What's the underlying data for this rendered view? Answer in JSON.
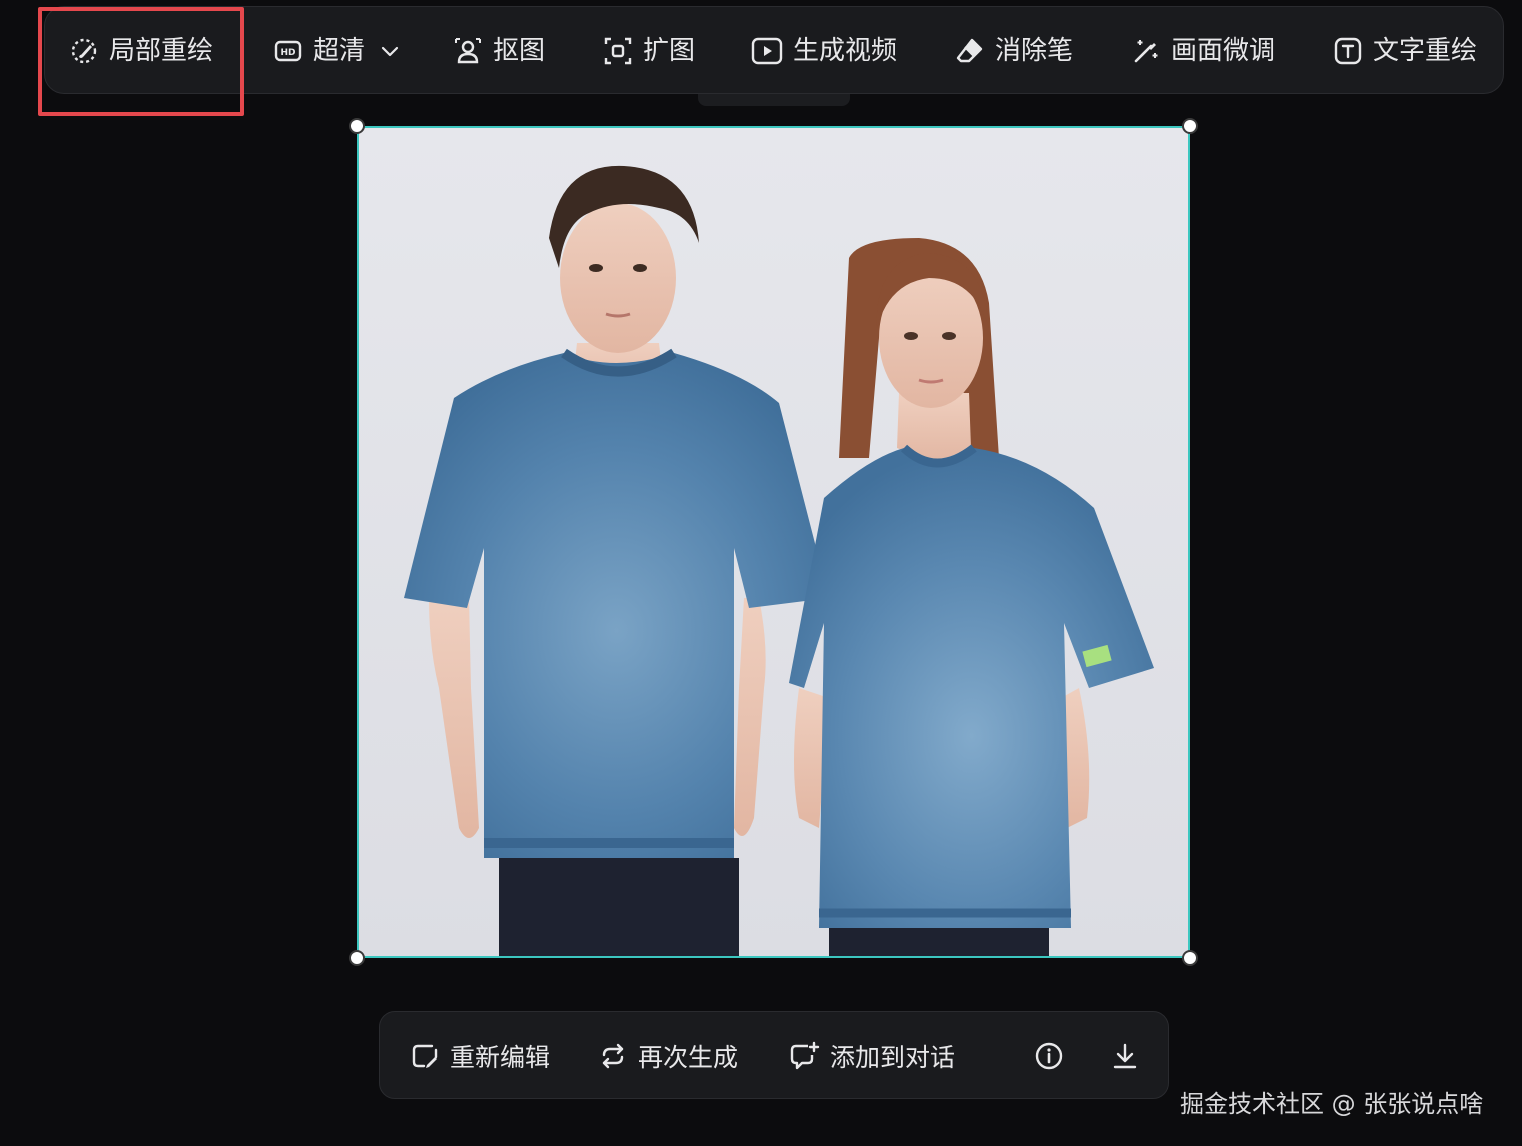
{
  "toolbar": {
    "items": [
      {
        "label": "局部重绘",
        "icon": "inpaint-icon"
      },
      {
        "label": "超清",
        "icon": "hd-icon",
        "has_dropdown": true
      },
      {
        "label": "抠图",
        "icon": "cutout-icon"
      },
      {
        "label": "扩图",
        "icon": "expand-icon"
      },
      {
        "label": "生成视频",
        "icon": "play-video-icon"
      },
      {
        "label": "消除笔",
        "icon": "eraser-icon"
      },
      {
        "label": "画面微调",
        "icon": "magic-wand-icon"
      },
      {
        "label": "文字重绘",
        "icon": "text-icon"
      }
    ],
    "highlighted_item": "局部重绘",
    "highlight_color": "#e5484d"
  },
  "canvas": {
    "selection_color": "#3cc7c0",
    "content": "two models wearing denim t-shirts"
  },
  "actions": {
    "items": [
      {
        "label": "重新编辑",
        "icon": "edit-icon"
      },
      {
        "label": "再次生成",
        "icon": "regenerate-icon"
      },
      {
        "label": "添加到对话",
        "icon": "add-to-chat-icon"
      },
      {
        "label": "",
        "icon": "info-icon"
      },
      {
        "label": "",
        "icon": "download-icon"
      }
    ]
  },
  "watermark": "掘金技术社区 @ 张张说点啥"
}
